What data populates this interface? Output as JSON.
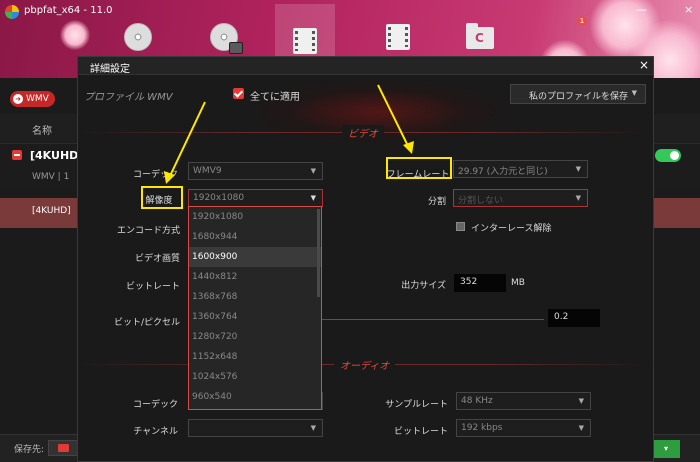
{
  "app": {
    "title": "pbpfat_x64 - 11.0"
  },
  "topnav": [
    {
      "name": "dvd-convert"
    },
    {
      "name": "dvd-copy"
    },
    {
      "name": "video-convert"
    },
    {
      "name": "video-edit"
    },
    {
      "name": "toolbox"
    }
  ],
  "notification_count": "1",
  "format_pill": {
    "label": "WMV"
  },
  "file_list": {
    "column_name": "名称",
    "file_title": "[4KUHD]",
    "file_meta": "WMV  |  1",
    "subtitle_row": "[4KUHD]"
  },
  "bottom": {
    "save_label": "保存先:",
    "run_label": "▾"
  },
  "dialog": {
    "title": "詳細設定",
    "close": "×",
    "profile_label": "プロファイル WMV",
    "apply_all": "全てに適用",
    "save_profile": "私のプロファイルを保存",
    "video_section": "ビデオ",
    "audio_section": "オーディオ",
    "video": {
      "codec_label": "コーデック",
      "codec_value": "WMV9",
      "resolution_label": "解像度",
      "resolution_value": "1920x1080",
      "encode_label": "エンコード方式",
      "quality_label": "ビデオ画質",
      "bitrate_label": "ビットレート",
      "bits_per_pixel_label": "ビット/ピクセル",
      "framerate_label": "フレームレート",
      "framerate_value": "29.97 (入力元と同じ)",
      "split_label": "分割",
      "split_value": "分割しない",
      "deinterlace_label": "インターレース解除",
      "output_size_label": "出力サイズ",
      "output_size_value": "352",
      "output_size_unit": "MB",
      "bits_per_pixel_value": "0.2"
    },
    "resolution_options": [
      "1920x1080",
      "1680x944",
      "1600x900",
      "1440x812",
      "1368x768",
      "1360x764",
      "1280x720",
      "1152x648",
      "1024x576",
      "960x540"
    ],
    "resolution_hover_index": 2,
    "audio": {
      "codec_label": "コーデック",
      "channel_label": "チャンネル",
      "samplerate_label": "サンプルレート",
      "samplerate_value": "48 KHz",
      "bitrate_label": "ビットレート",
      "bitrate_value": "192 kbps"
    }
  }
}
